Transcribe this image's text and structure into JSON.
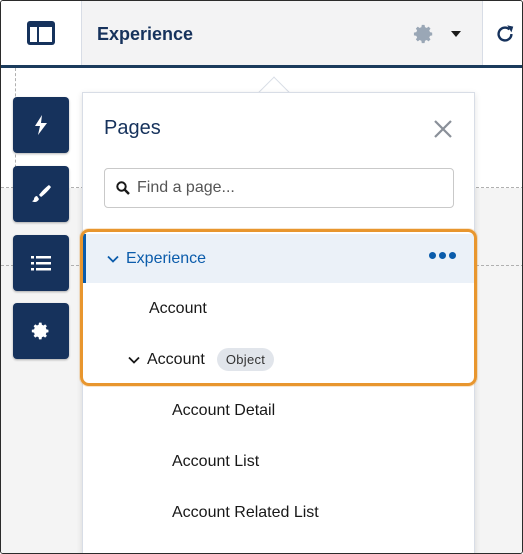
{
  "header": {
    "title": "Experience",
    "layout_icon": "layout-icon",
    "settings_icon": "gear-icon",
    "menu_icon": "caret-down-icon",
    "refresh_icon": "refresh-icon"
  },
  "tools": [
    {
      "icon": "lightning-icon"
    },
    {
      "icon": "brush-icon"
    },
    {
      "icon": "list-icon"
    },
    {
      "icon": "gear-icon"
    }
  ],
  "pages_panel": {
    "title": "Pages",
    "close_icon": "close-icon",
    "search": {
      "placeholder": "Find a page...",
      "value": "",
      "icon": "search-icon"
    },
    "tree": [
      {
        "label": "Experience",
        "expanded": true,
        "selected": true,
        "more_icon": "more-icon"
      },
      {
        "label": "Account"
      },
      {
        "label": "Account",
        "expanded": true,
        "badge": "Object"
      },
      {
        "label": "Account Detail"
      },
      {
        "label": "Account List"
      },
      {
        "label": "Account Related List"
      }
    ]
  },
  "colors": {
    "navy": "#16325c",
    "brand_blue": "#0b5cab",
    "selected_bg": "#ebf1f8",
    "highlight_orange": "#e8962e"
  }
}
